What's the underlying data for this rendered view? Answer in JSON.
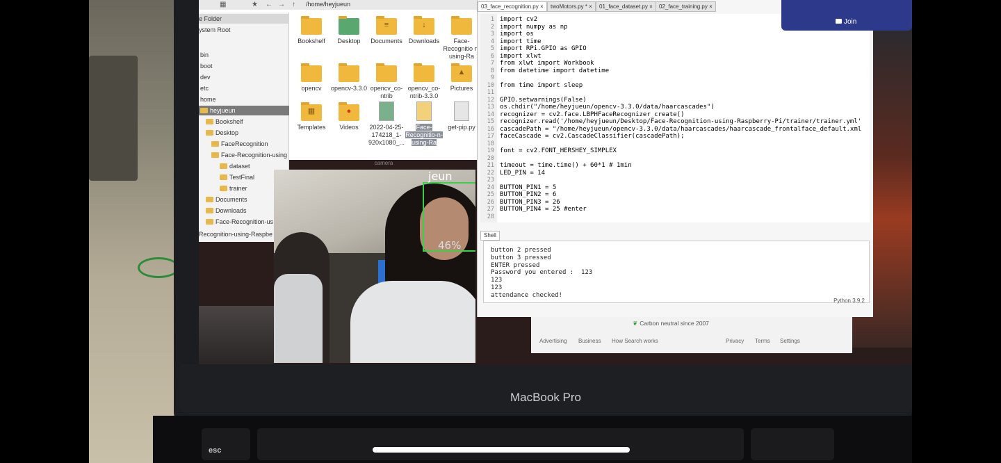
{
  "file_manager": {
    "path": "/home/heyjueun",
    "sidebar": {
      "header_items": [
        "e Folder",
        "ystem Root"
      ],
      "items": [
        "bin",
        "boot",
        "dev",
        "etc",
        "home",
        "heyjueun",
        "Bookshelf",
        "Desktop",
        "FaceRecognition",
        "Face-Recognition-using",
        "dataset",
        "TestFinal",
        "trainer",
        "Documents",
        "Downloads",
        "Face-Recognition-us",
        "Recognition-using-Raspbe"
      ]
    },
    "items": [
      {
        "label": "Bookshelf",
        "icon": "folder-icon"
      },
      {
        "label": "Desktop",
        "icon": "desktop-folder-icon"
      },
      {
        "label": "Documents",
        "icon": "documents-folder-icon"
      },
      {
        "label": "Downloads",
        "icon": "downloads-folder-icon"
      },
      {
        "label": "Face-Recognitio n-using-Ra",
        "icon": "folder-icon"
      },
      {
        "label": "opencv",
        "icon": "folder-icon"
      },
      {
        "label": "opencv-3.3.0",
        "icon": "folder-icon"
      },
      {
        "label": "opencv_co-ntrib",
        "icon": "folder-icon"
      },
      {
        "label": "opencv_co-ntrib-3.3.0",
        "icon": "folder-icon"
      },
      {
        "label": "Pictures",
        "icon": "pictures-folder-icon"
      },
      {
        "label": "Templates",
        "icon": "templates-folder-icon"
      },
      {
        "label": "Videos",
        "icon": "videos-folder-icon"
      },
      {
        "label": "2022-04-25-174218_1-920x1080_...",
        "icon": "image-file-icon"
      },
      {
        "label": "Face-Recognitio-n-using-Ra",
        "icon": "archive-file-icon"
      },
      {
        "label": "get-pip.py",
        "icon": "text-file-icon"
      }
    ]
  },
  "camera": {
    "title": "camera",
    "name_label": "jeun",
    "confidence": "46%"
  },
  "editor": {
    "tabs": [
      "03_face_recognition.py",
      "twoMotors.py *",
      "01_face_dataset.py",
      "02_face_training.py"
    ],
    "code_lines": [
      "import cv2",
      "import numpy as np",
      "import os",
      "import time",
      "import RPi.GPIO as GPIO",
      "import xlwt",
      "from xlwt import Workbook",
      "from datetime import datetime",
      "",
      "from time import sleep",
      "",
      "GPIO.setwarnings(False)",
      "os.chdir(\"/home/heyjueun/opencv-3.3.0/data/haarcascades\")",
      "recognizer = cv2.face.LBPHFaceRecognizer_create()",
      "recognizer.read('/home/heyjueun/Desktop/Face-Recognition-using-Raspberry-Pi/trainer/trainer.yml'",
      "cascadePath = \"/home/heyjueun/opencv-3.3.0/data/haarcascades/haarcascade_frontalface_default.xml",
      "faceCascade = cv2.CascadeClassifier(cascadePath);",
      "",
      "font = cv2.FONT_HERSHEY_SIMPLEX",
      "",
      "timeout = time.time() + 60*1 # 1min",
      "LED_PIN = 14",
      "",
      "BUTTON_PIN1 = 5",
      "BUTTON_PIN2 = 6",
      "BUTTON_PIN3 = 26",
      "BUTTON_PIN4 = 25 #enter",
      ""
    ],
    "shell_tab": "Shell",
    "shell_lines": [
      "button 2 pressed",
      "button 3 pressed",
      "ENTER pressed",
      "Password you entered :  123",
      "123",
      "123",
      "attendance checked!"
    ],
    "python_version": "Python 3.9.2"
  },
  "browser_footer": {
    "carbon": "Carbon neutral since 2007",
    "links_left": [
      "Advertising",
      "Business",
      "How Search works"
    ],
    "links_right": [
      "Privacy",
      "Terms",
      "Settings"
    ]
  },
  "meeting": {
    "join_label": "Join"
  },
  "laptop": {
    "brand_label": "MacBook Pro",
    "esc_key": "esc"
  }
}
